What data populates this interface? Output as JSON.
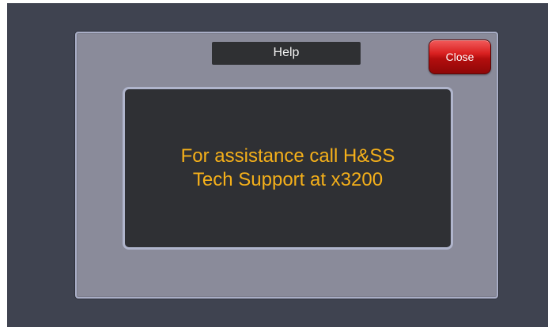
{
  "dialog": {
    "title": "Help",
    "close_label": "Close",
    "message_line1": "For assistance call H&SS",
    "message_line2": "Tech Support at x3200"
  },
  "colors": {
    "screen_background": "#3f4350",
    "dialog_background": "#8a8b9a",
    "panel_background": "#2f3034",
    "message_text": "#f5b01a",
    "close_button": "#c41515"
  }
}
